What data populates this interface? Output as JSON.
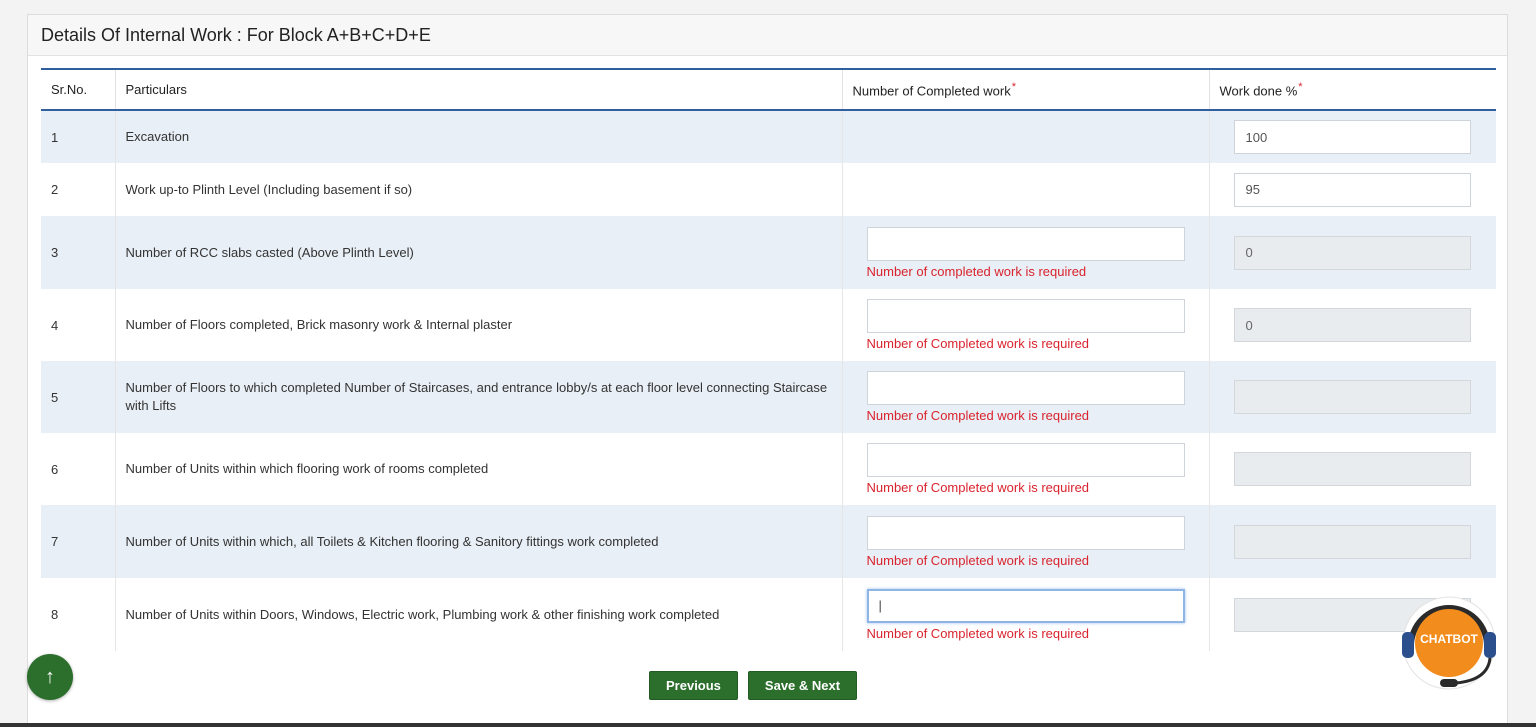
{
  "panel": {
    "title": "Details Of Internal Work : For Block A+B+C+D+E"
  },
  "table": {
    "headers": {
      "srno": "Sr.No.",
      "particulars": "Particulars",
      "completed": "Number of Completed work",
      "required_mark": "*",
      "workdone": "Work done %"
    },
    "rows": [
      {
        "sr": "1",
        "particular": "Excavation",
        "has_completed_input": false,
        "completed_value": "",
        "error": "",
        "workdone": "100",
        "workdone_disabled": false
      },
      {
        "sr": "2",
        "particular": "Work up-to Plinth Level (Including basement if so)",
        "has_completed_input": false,
        "completed_value": "",
        "error": "",
        "workdone": "95",
        "workdone_disabled": false
      },
      {
        "sr": "3",
        "particular": "Number of RCC slabs casted (Above Plinth Level)",
        "has_completed_input": true,
        "completed_value": "",
        "error": "Number of completed work is required",
        "workdone": "0",
        "workdone_disabled": true
      },
      {
        "sr": "4",
        "particular": "Number of Floors completed, Brick masonry work & Internal plaster",
        "has_completed_input": true,
        "completed_value": "",
        "error": "Number of Completed work is required",
        "workdone": "0",
        "workdone_disabled": true
      },
      {
        "sr": "5",
        "particular": "Number of Floors to which completed Number of Staircases, and entrance lobby/s at each floor level connecting Staircase with Lifts",
        "has_completed_input": true,
        "completed_value": "",
        "error": "Number of Completed work is required",
        "workdone": "",
        "workdone_disabled": true
      },
      {
        "sr": "6",
        "particular": "Number of Units within which flooring work of rooms completed",
        "has_completed_input": true,
        "completed_value": "",
        "error": "Number of Completed work is required",
        "workdone": "",
        "workdone_disabled": true
      },
      {
        "sr": "7",
        "particular": "Number of Units within which, all Toilets & Kitchen flooring & Sanitory fittings work completed",
        "has_completed_input": true,
        "completed_value": "",
        "error": "Number of Completed work is required",
        "workdone": "",
        "workdone_disabled": true
      },
      {
        "sr": "8",
        "particular": "Number of Units within Doors, Windows, Electric work, Plumbing work & other finishing work completed",
        "has_completed_input": true,
        "completed_value": "|",
        "error": "Number of Completed work is required",
        "workdone": "",
        "workdone_disabled": true,
        "focused": true
      }
    ]
  },
  "buttons": {
    "previous": "Previous",
    "save_next": "Save & Next"
  },
  "scroll_top": {
    "icon": "arrow-up-icon",
    "glyph": "↑"
  },
  "chatbot": {
    "label": "CHATBOT",
    "icon": "headset-icon"
  },
  "colors": {
    "primary_green": "#2c6e2c",
    "header_border": "#2f5f9e",
    "error_red": "#d9232d",
    "row_stripe": "#e9eff6",
    "chatbot_orange": "#f28c1c"
  }
}
